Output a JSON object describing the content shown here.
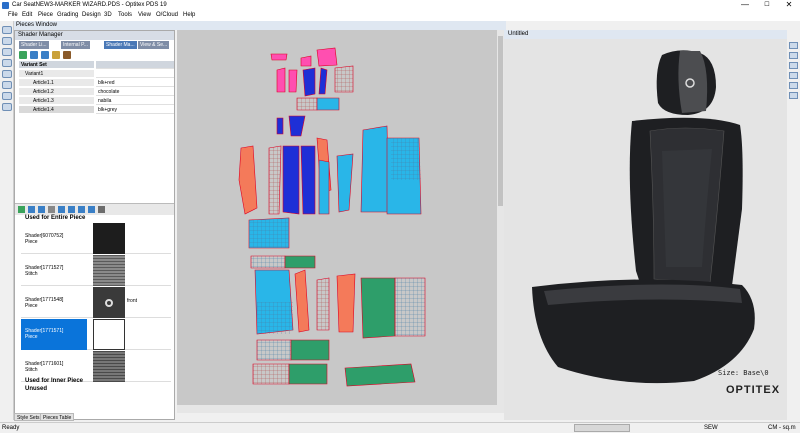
{
  "app": {
    "title": "Car SeatNEW3-MARKER WIZARD.PDS - Optitex PDS 19",
    "window_controls": [
      "—",
      "☐",
      "✕"
    ]
  },
  "menu": [
    "File",
    "Edit",
    "Piece",
    "Grading",
    "Design",
    "3D",
    "Tools",
    "View",
    "O/Cloud",
    "Help"
  ],
  "pieces_window": {
    "title": "Pieces Window"
  },
  "shader_manager": {
    "title": "Shader Manager",
    "tabs": [
      "Shader Li...",
      "Internal P...",
      "Shader Ma...",
      "View & Se..."
    ],
    "selected_tab": 2,
    "variant_header": "Variant Set",
    "variant_root": "Variant1",
    "variants": [
      {
        "name": "Article1.1",
        "value": "blk+red"
      },
      {
        "name": "Article1.2",
        "value": "chocolate"
      },
      {
        "name": "Article1.3",
        "value": "nabila"
      },
      {
        "name": "Article1.4",
        "value": "blk+grey"
      }
    ],
    "used_for_entire": "Used for Entire Piece",
    "shaders": [
      {
        "name": "Shader[6070752]",
        "type": "Piece",
        "extra": ""
      },
      {
        "name": "Shader[1771527]",
        "type": "Stitch",
        "extra": ""
      },
      {
        "name": "Shader[1771548]",
        "type": "Piece",
        "extra": "front"
      },
      {
        "name": "Shader[1771571]",
        "type": "Piece",
        "extra": ""
      },
      {
        "name": "Shader[1771601]",
        "type": "Stitch",
        "extra": ""
      }
    ],
    "used_for_inner": "Used for Inner Piece",
    "unused": "Unused"
  },
  "viewer": {
    "title": "Untitled",
    "size_label": "Size: Base\\0",
    "logo": "OPTITEX"
  },
  "bottom_tabs": [
    "Style Sets",
    "Pieces Table"
  ],
  "status": {
    "left": "Ready",
    "mode": "SEW",
    "units": "CM - sq.m"
  },
  "colors": {
    "pink": "#ff4fb0",
    "blue": "#1e2fd6",
    "salmon": "#f47a5a",
    "cyan": "#29b6e8",
    "green": "#2e9e6a",
    "grid": "#5a88a8",
    "seat": "#1e1f22"
  }
}
